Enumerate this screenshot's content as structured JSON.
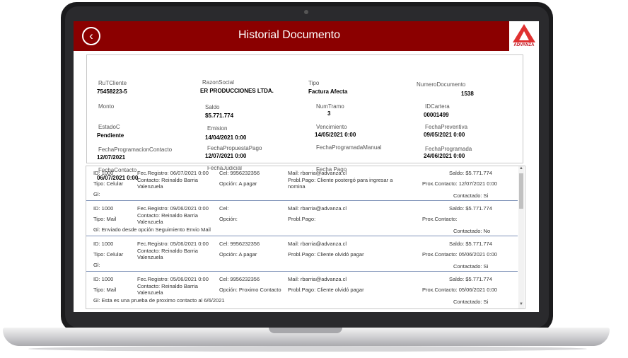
{
  "header": {
    "title": "Historial Documento",
    "logo_text": "ADVANZA"
  },
  "doc": {
    "rutcliente_label": "RuTCliente",
    "rutcliente_value": "75458223-5",
    "razonsocial_label": "RazonSocial",
    "razonsocial_value": "ER PRODUCCIONES LTDA.",
    "tipo_label": "Tipo",
    "tipo_value": "Factura Afecta",
    "numerodocumento_label": "NumeroDocumento",
    "numerodocumento_value": "1538",
    "monto_label": "Monto",
    "saldo_label": "Saldo",
    "saldo_value": "$5.771.774",
    "numtramo_label": "NumTramo",
    "numtramo_value": "3",
    "idcartera_label": "IDCartera",
    "idcartera_value": "00001499",
    "estado_label": "EstadoC",
    "estado_value": "Pendiente",
    "emision_label": "Emision",
    "emision_value": "14/04/2021 0:00",
    "vencimiento_label": "Vencimiento",
    "vencimiento_value": "14/05/2021 0:00",
    "fechapreventiva_label": "FechaPreventiva",
    "fechapreventiva_value": "09/05/2021 0:00",
    "fechaprogramacioncontacto_label": "FechaProgramacionContacto",
    "fechaprogramacioncontacto_value": "12/07/2021",
    "fechapropuestapago_label": "FechaPropuestaPago",
    "fechapropuestapago_value": "12/07/2021 0:00",
    "fechaprogramadamanual_label": "FechaProgramadaManual",
    "fechaprogramada_label": "FechaProgramada",
    "fechaprogramada_value": "24/06/2021 0:00",
    "fechacontacto_label": "FechaContacto",
    "fechacontacto_value": "06/07/2021 0:00",
    "fechajudicial_label": "FechaJudicial",
    "fechapago_label": "Fecha Pago"
  },
  "records": [
    {
      "id": "ID: 1000",
      "fec": "Fec.Registro: 06/07/2021 0:00",
      "cel": "Cel: 9956232356",
      "mail": "Mail: rbarria@advanza.cl",
      "saldo": "Saldo: $5.771.774",
      "tipo": "Tipo: Celular",
      "contacto1": "Contacto: Reinaldo Barria",
      "contacto2": "Valenzuela",
      "opcion": "Opción: A pagar",
      "probl1": "Probl.Pago: Cliente postergó para ingresar a",
      "probl2": "nomina",
      "prox": "Prox.Contacto: 12/07/2021 0:00",
      "gl": "Gl:",
      "contactado": "Contactado: Si"
    },
    {
      "id": "ID: 1000",
      "fec": "Fec.Registro: 09/06/2021 0:00",
      "cel": "Cel:",
      "mail": "Mail: rbarria@advanza.cl",
      "saldo": "Saldo: $5.771.774",
      "tipo": "Tipo: Mail",
      "contacto1": "Contacto: Reinaldo Barria",
      "contacto2": "Valenzuela",
      "opcion": "Opción:",
      "probl1": "Probl.Pago:",
      "probl2": "",
      "prox": "Prox.Contacto:",
      "gl": "Gl: Enviado desde opción Seguimiento Envio Mail",
      "contactado": "Contactado: No"
    },
    {
      "id": "ID: 1000",
      "fec": "Fec.Registro: 05/06/2021 0:00",
      "cel": "Cel: 9956232356",
      "mail": "Mail: rbarria@advanza.cl",
      "saldo": "Saldo: $5.771.774",
      "tipo": "Tipo: Celular",
      "contacto1": "Contacto: Reinaldo Barria",
      "contacto2": "Valenzuela",
      "opcion": "Opción: A pagar",
      "probl1": "Probl.Pago: Cliente olvidó pagar",
      "probl2": "",
      "prox": "Prox.Contacto: 05/06/2021 0:00",
      "gl": "Gl:",
      "contactado": "Contactado: Si"
    },
    {
      "id": "ID: 1000",
      "fec": "Fec.Registro: 05/06/2021 0:00",
      "cel": "Cel: 9956232356",
      "mail": "Mail: rbarria@advanza.cl",
      "saldo": "Saldo: $5.771.774",
      "tipo": "Tipo: Mail",
      "contacto1": "Contacto: Reinaldo Barria",
      "contacto2": "Valenzuela",
      "opcion": "Opción: Proximo Contacto",
      "probl1": "Probl.Pago: Cliente olvidó pagar",
      "probl2": "",
      "prox": "Prox.Contacto: 05/06/2021 0:00",
      "gl": "Gl: Esta es una prueba de proximo contacto al 6/6/2021",
      "contactado": "Contactado: Si"
    }
  ]
}
